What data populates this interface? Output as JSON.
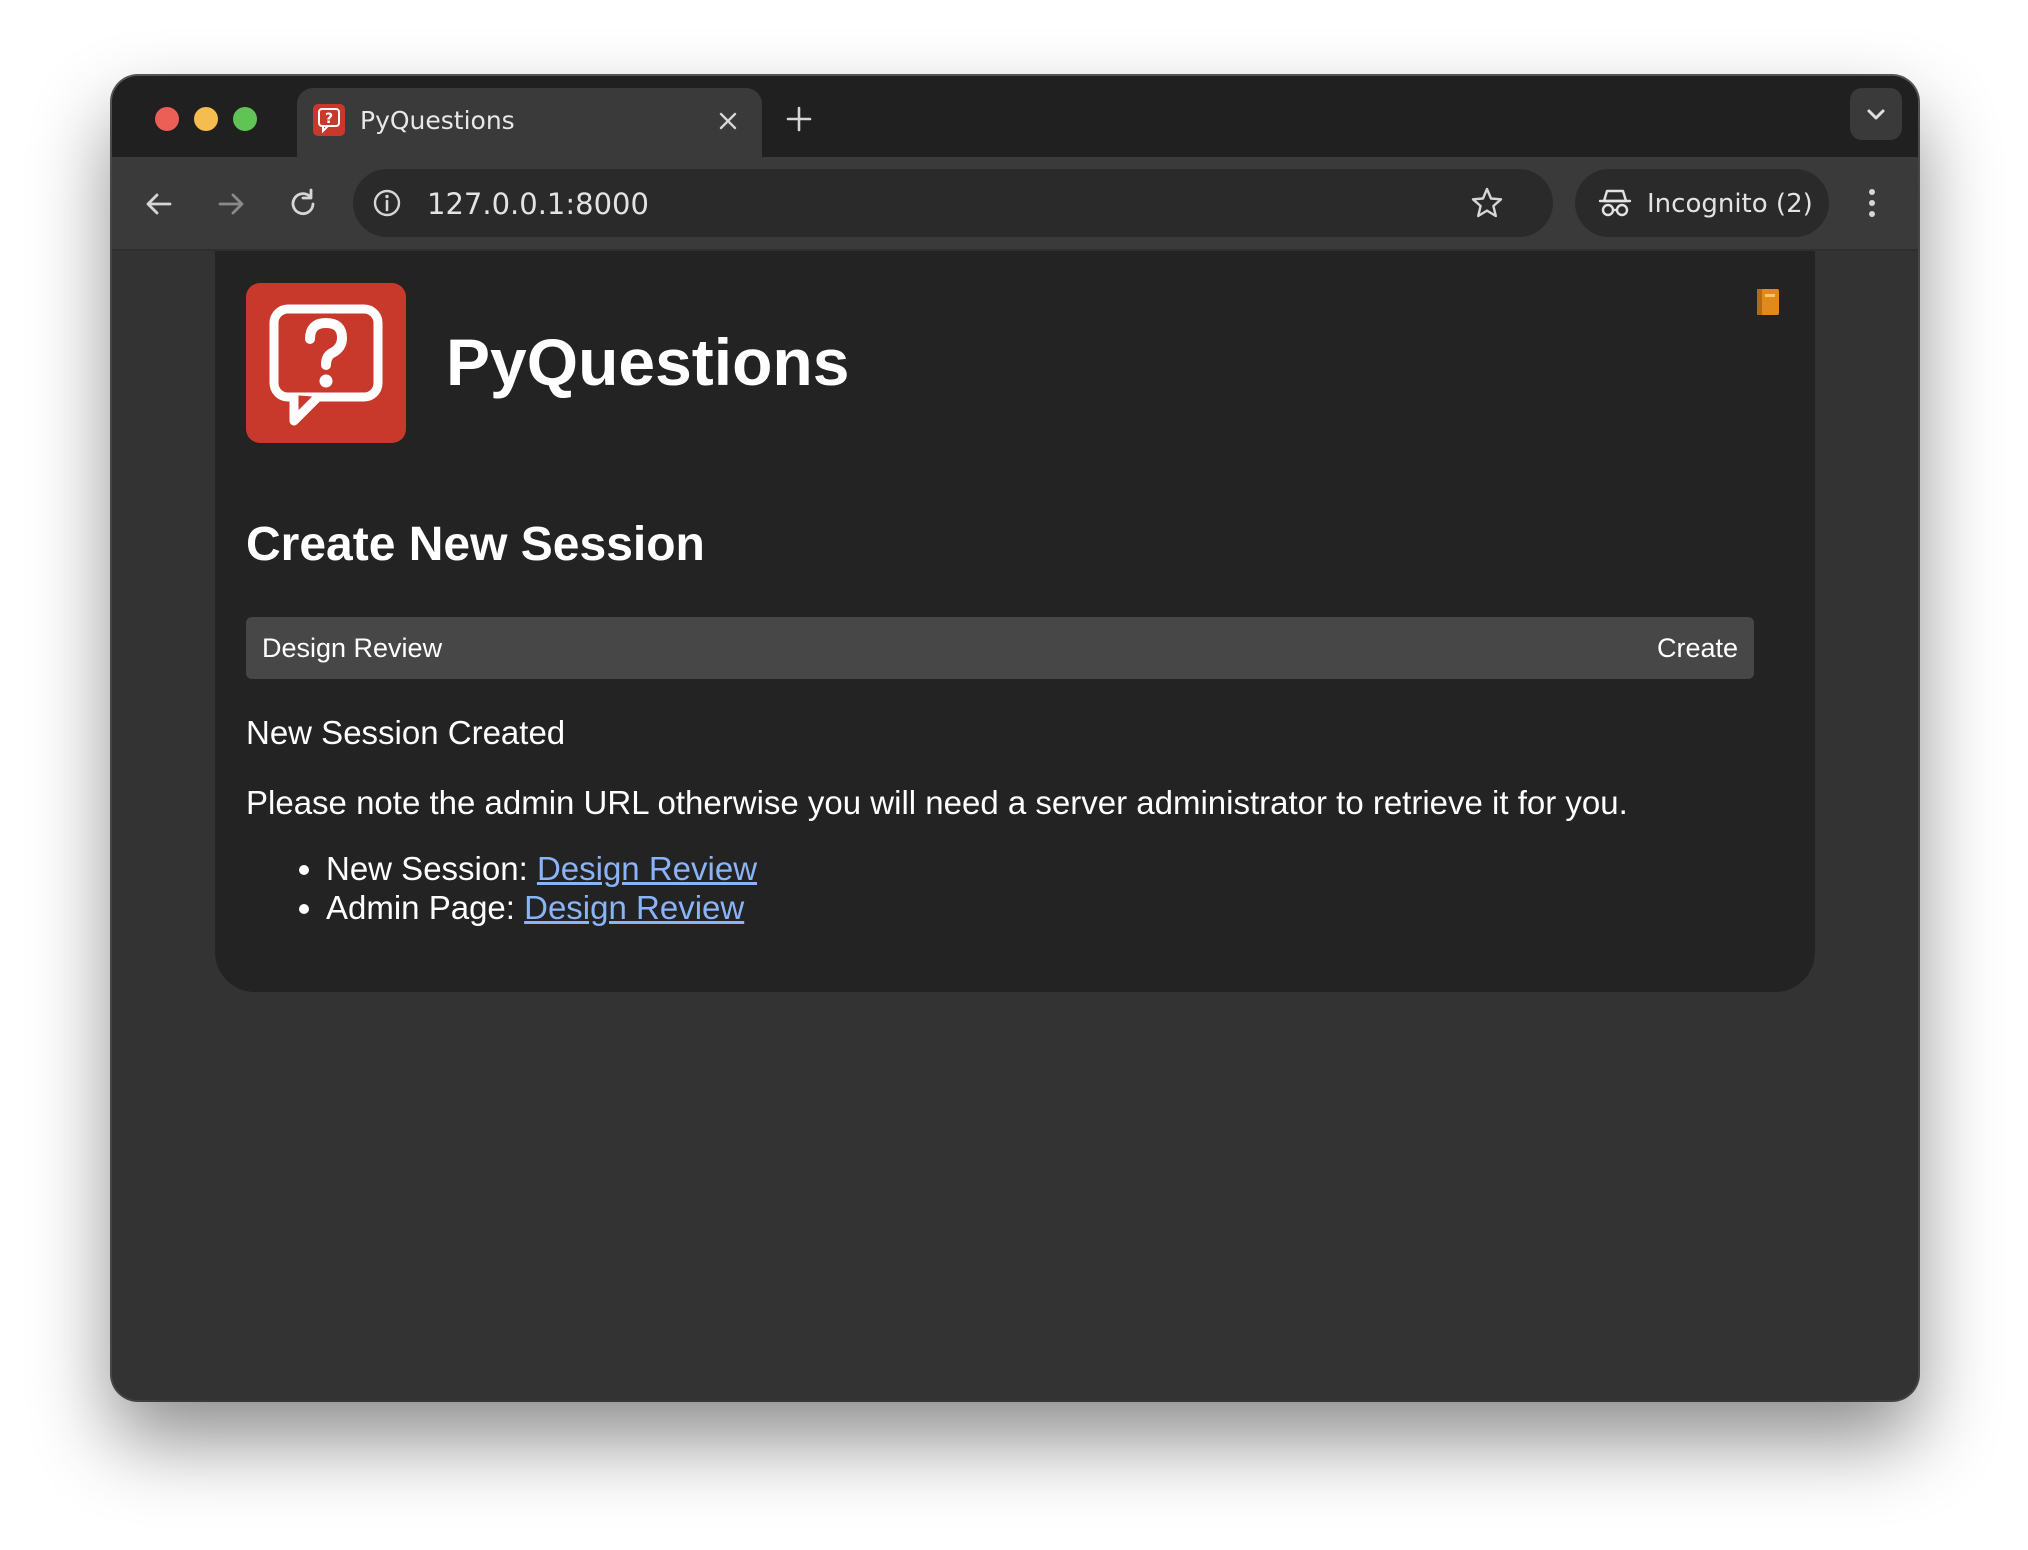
{
  "browser": {
    "tab": {
      "title": "PyQuestions"
    },
    "omnibox": {
      "url": "127.0.0.1:8000"
    },
    "profile": {
      "label": "Incognito (2)"
    }
  },
  "page": {
    "app_title": "PyQuestions",
    "section_title": "Create New Session",
    "form": {
      "session_name_value": "Design Review",
      "create_label": "Create"
    },
    "status": "New Session Created",
    "note": "Please note the admin URL otherwise you will need a server administrator to retrieve it for you.",
    "links": [
      {
        "label": "New Session:",
        "link_text": "Design Review"
      },
      {
        "label": "Admin Page:",
        "link_text": "Design Review"
      }
    ]
  },
  "colors": {
    "brand_red": "#c9392b",
    "link_blue": "#8ab4f8",
    "card_bg": "#232323",
    "page_bg": "#333333"
  },
  "icons": [
    "close-icon",
    "plus-icon",
    "chevron-down-icon",
    "back-arrow-icon",
    "forward-arrow-icon",
    "reload-icon",
    "info-icon",
    "star-icon",
    "incognito-icon",
    "kebab-menu-icon",
    "question-bubble-icon",
    "book-icon"
  ]
}
